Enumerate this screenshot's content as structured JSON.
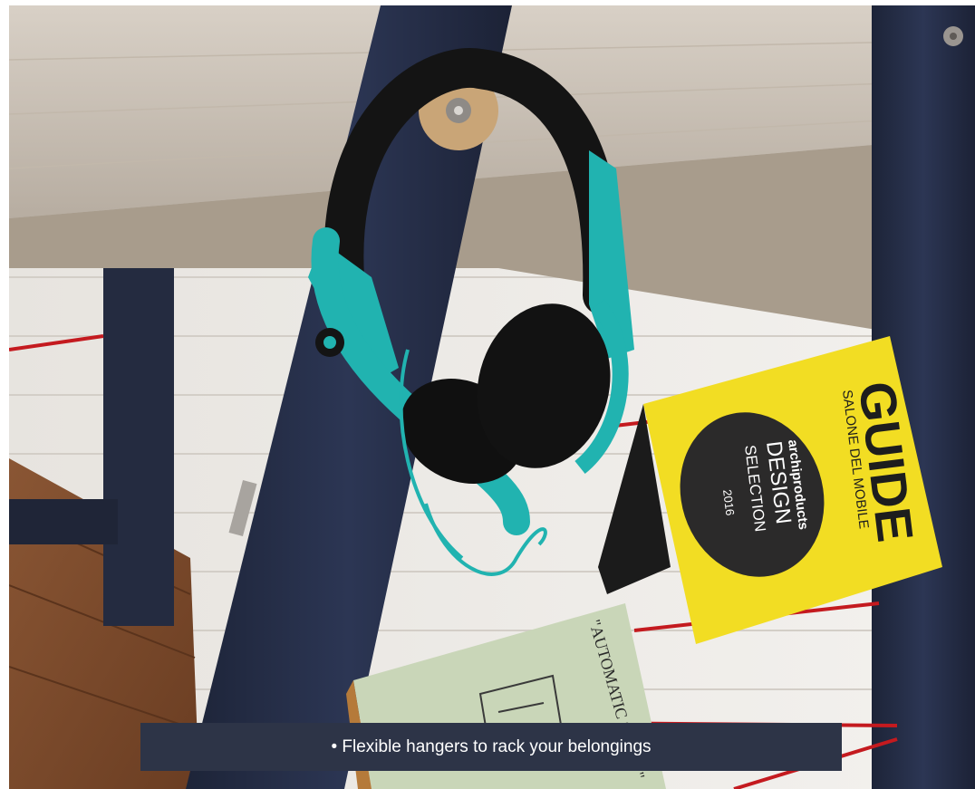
{
  "caption": {
    "text": "• Flexible hangers to rack your belongings"
  },
  "photo": {
    "guide_booklet": {
      "title": "GUIDE",
      "subtitle": "SALONE DEL MOBILE",
      "brand": "archiproducts",
      "line1": "DESIGN",
      "line2": "SELECTION",
      "year": "2016"
    },
    "green_book": {
      "title": "\"AUTOMATIC STORY\""
    }
  },
  "colors": {
    "frame_navy": "#27304a",
    "headphone_teal": "#21b3b0",
    "booklet_yellow": "#f2dd23",
    "wood_shelf": "#cfc5b8",
    "cord_red": "#c41a1f",
    "caption_bg": "#2d3447"
  }
}
